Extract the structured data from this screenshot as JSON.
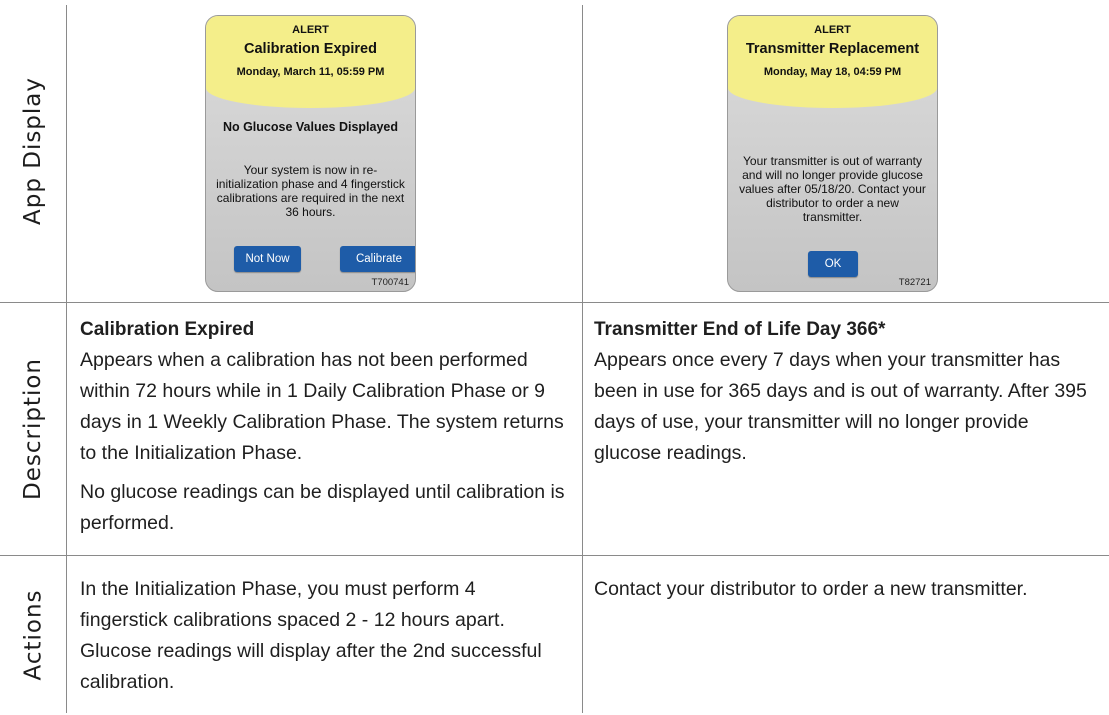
{
  "row_headers": {
    "app_display": "App Display",
    "description": "Description",
    "actions": "Actions"
  },
  "left": {
    "phone": {
      "alert_label": "ALERT",
      "title": "Calibration Expired",
      "datetime": "Monday, March 11, 05:59 PM",
      "subtitle": "No Glucose Values Displayed",
      "body": "Your system is now in re-initialization phase and 4 fingerstick calibrations are required in the next 36 hours.",
      "button_left": "Not Now",
      "button_right": "Calibrate",
      "code": "T700741"
    },
    "description": {
      "title": "Calibration Expired",
      "text1": "Appears when a calibration has not been performed within 72 hours while in 1 Daily Calibration Phase or 9 days in 1 Weekly Calibration Phase. The system returns to the Initialization Phase.",
      "text2": "No glucose readings can be displayed until calibration is performed."
    },
    "actions": "In the Initialization Phase, you must perform 4 fingerstick calibrations spaced 2 - 12 hours apart. Glucose readings will display after the 2nd successful calibration."
  },
  "right": {
    "phone": {
      "alert_label": "ALERT",
      "title": "Transmitter Replacement",
      "datetime": "Monday, May 18, 04:59 PM",
      "body": "Your transmitter is out of warranty and will no longer provide glucose values after 05/18/20. Contact your distributor to order a new transmitter.",
      "button": "OK",
      "code": "T82721"
    },
    "description": {
      "title": "Transmitter End of Life Day 366*",
      "text1": "Appears once every 7 days when your transmitter has been in use for 365 days and is out of warranty. After 395 days of use, your transmitter will no longer provide glucose readings."
    },
    "actions": "Contact your distributor to order a new transmitter."
  }
}
